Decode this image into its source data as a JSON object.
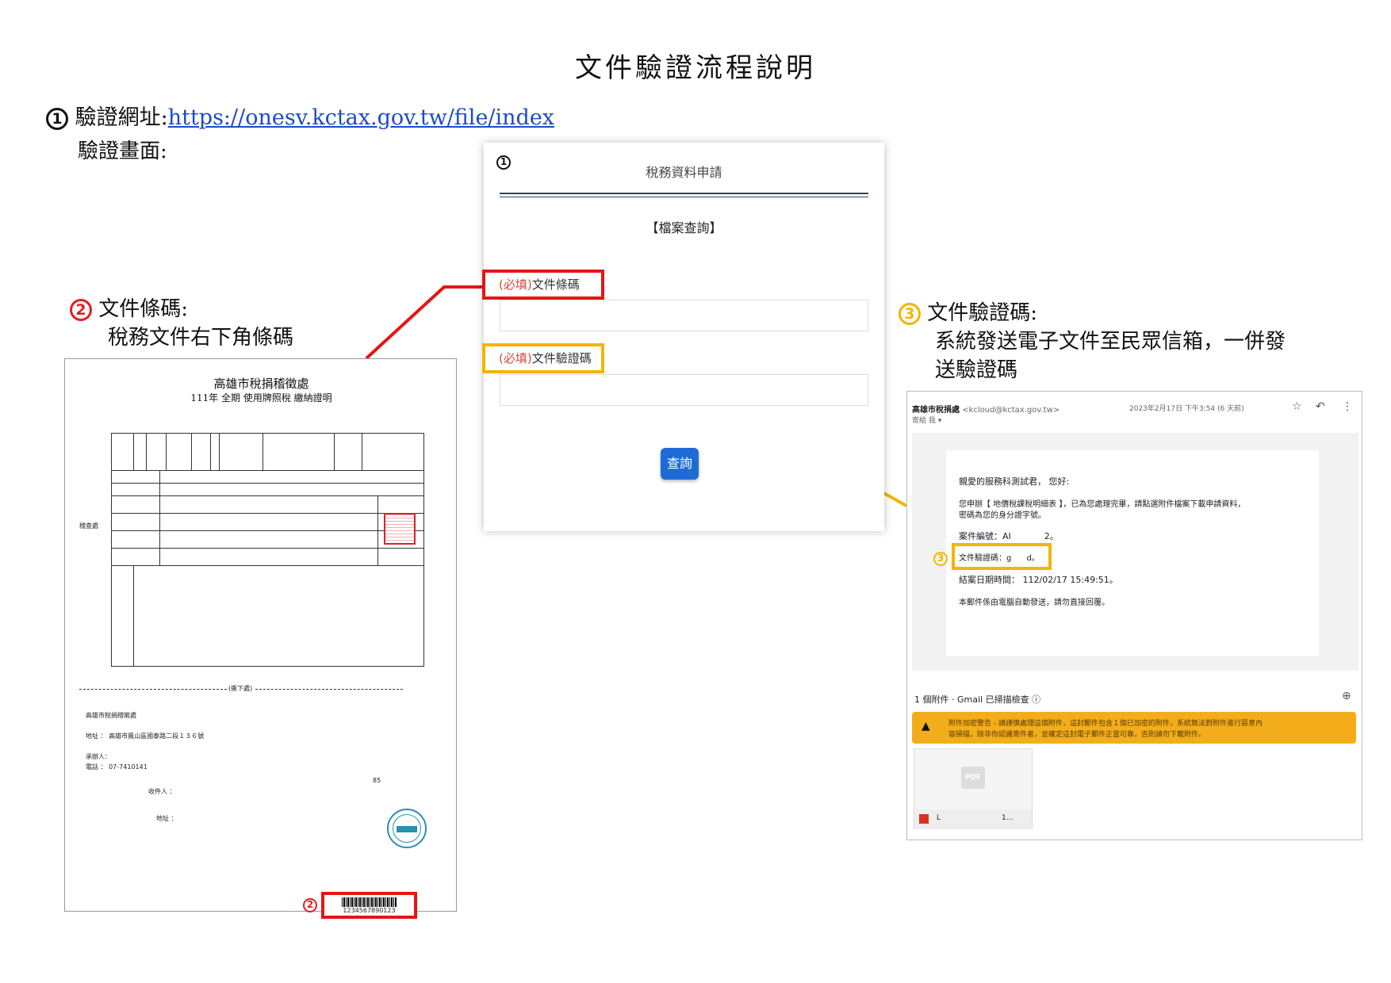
{
  "title": "文件驗證流程說明",
  "step1": {
    "number": "1",
    "label": "驗證網址:",
    "url": "https://onesv.kctax.gov.tw/file/index",
    "screen_label": "驗證畫面:"
  },
  "form": {
    "badge": "1",
    "title": "稅務資料申請",
    "subtitle": "【檔案查詢】",
    "required_mark": "(必填)",
    "barcode_label": "文件條碼",
    "code_label": "文件驗證碼",
    "query_button": "查詢"
  },
  "step2": {
    "number": "2",
    "line1": "文件條碼:",
    "line2": "稅務文件右下角條碼"
  },
  "step3": {
    "number": "3",
    "line1": "文件驗證碼:",
    "line2": "系統發送電子文件至民眾信箱，一併發",
    "line3": "送驗證碼"
  },
  "certificate": {
    "org": "高雄市稅捐稽徵處",
    "heading": "111年 全期 使用牌照稅 繳納證明",
    "sender": "高雄市稅捐稽徵處",
    "address": "地址 ： 高雄市鳳山區國泰路二段１３６號",
    "contact": "承辦人：",
    "phone": "電話 ： 07-7410141",
    "number": "85",
    "recipient": "收件人 ：",
    "recipient_addr": "地址 ：",
    "barcode_number": "1234567890123",
    "barcode_badge": "2",
    "cut_line": "(撕下處)",
    "side_label": "稽查處"
  },
  "email": {
    "sender_name": "高雄市稅捐處",
    "sender_email": "<kcloud@kctax.gov.tw>",
    "to": "寄給 我 ▾",
    "date": "2023年2月17日 下午3:54 (6 天前)",
    "greeting": "親愛的服務科測試君， 您好:",
    "body1": "您申辦【 地價稅課稅明細表 】，已為您處理完畢，請點選附件檔案下載申請資料，",
    "body2": "密碼為您的身分證字號。",
    "case_label": "案件編號：AI",
    "case_tail": "2。",
    "code_badge": "3",
    "code_label": "文件驗證碼：g",
    "code_tail": "d。",
    "done_time": "結案日期時間： 112/02/17 15:49:51。",
    "notice": "本郵件係由電腦自動發送，請勿直接回覆。",
    "attachments": "1 個附件 · Gmail 已掃描檢查 ⓘ",
    "warning1": "附件加密警告 - 請謹慎處理這個附件，這封郵件包含１個已加密的附件，系統無法對附件進行惡意內",
    "warning2": "容掃描，除非你認識寄件者，並確定這封電子郵件正當可靠，否則請勿下載附件。",
    "pdf_label": "PDF",
    "file_name": "L",
    "file_size": "1..."
  }
}
